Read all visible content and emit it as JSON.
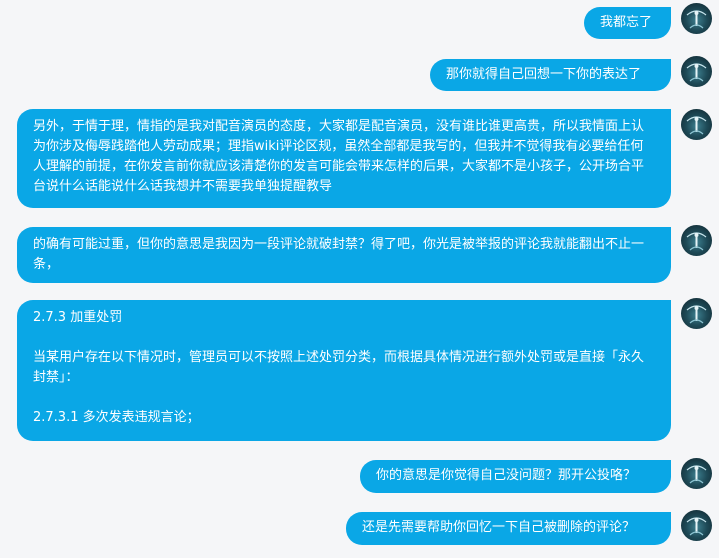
{
  "messages": [
    {
      "id": "m1",
      "text": "我都忘了"
    },
    {
      "id": "m2",
      "text": "那你就得自己回想一下你的表达了"
    },
    {
      "id": "m3",
      "text": "另外，于情于理，情指的是我对配音演员的态度，大家都是配音演员，没有谁比谁更高贵，所以我情面上认为你涉及侮辱践踏他人劳动成果；理指wiki评论区规，虽然全部都是我写的，但我并不觉得我有必要给任何人理解的前提，在你发言前你就应该清楚你的发言可能会带来怎样的后果，大家都不是小孩子，公开场合平台说什么话能说什么话我想并不需要我单独提醒教导"
    },
    {
      "id": "m4",
      "text": "的确有可能过重，但你的意思是我因为一段评论就破封禁？得了吧，你光是被举报的评论我就能翻出不止一条，"
    },
    {
      "id": "m5",
      "text": "2.7.3 加重处罚\n\n当某用户存在以下情况时，管理员可以不按照上述处罚分类，而根据具体情况进行额外处罚或是直接「永久封禁」：\n\n2.7.3.1 多次发表违规言论；"
    },
    {
      "id": "m6",
      "text": "你的意思是你觉得自己没问题？那开公投咯？"
    },
    {
      "id": "m7",
      "text": "还是先需要帮助你回忆一下自己被删除的评论？"
    }
  ],
  "avatar_icon": "user-avatar-icon",
  "colors": {
    "bubble": "#0aa7e6",
    "background": "#f5f6f8",
    "text": "#ffffff"
  }
}
